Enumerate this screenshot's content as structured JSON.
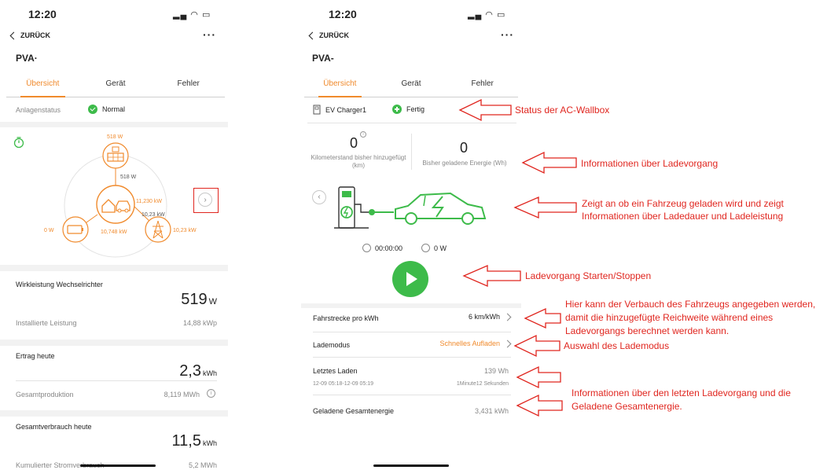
{
  "phone1": {
    "time": "12:20",
    "back_label": "ZURÜCK",
    "title": "PVA·",
    "tabs": [
      "Übersicht",
      "Gerät",
      "Fehler"
    ],
    "status_label": "Anlagenstatus",
    "status_value": "Normal",
    "flow": {
      "pv": "518 W",
      "pv_to_home": "518 W",
      "grid_in": "11,230 kW",
      "grid_a": "10,23 kW",
      "grid_b": "10,23 kW",
      "battery": "0 W",
      "home_to_grid": "10,748 kW"
    },
    "wirk_label": "Wirkleistung Wechselrichter",
    "wirk_value": "519",
    "wirk_unit": "W",
    "inst_label": "Installierte Leistung",
    "inst_value": "14,88 kWp",
    "ertrag_label": "Ertrag heute",
    "ertrag_value": "2,3",
    "ertrag_unit": "kWh",
    "gesamt_label": "Gesamtproduktion",
    "gesamt_value": "8,119 MWh",
    "verbrauch_label": "Gesamtverbrauch heute",
    "verbrauch_value": "11,5",
    "verbrauch_unit": "kWh",
    "kumul_label": "Kumulierter Stromverbrauch",
    "kumul_value": "5,2 MWh"
  },
  "phone2": {
    "time": "12:20",
    "back_label": "ZURÜCK",
    "title": "PVA-",
    "tabs": [
      "Übersicht",
      "Gerät",
      "Fehler"
    ],
    "charger_name": "EV Charger1",
    "charger_status": "Fertig",
    "km_value": "0",
    "km_label": "Kilometerstand bisher hinzugefügt (km)",
    "energy_value": "0",
    "energy_label": "Bisher geladene Energie (Wh)",
    "duration": "00:00:00",
    "power": "0 W",
    "rows": [
      {
        "label": "Fahrstrecke pro kWh",
        "value": "6 km/kWh"
      },
      {
        "label": "Lademodus",
        "value": "Schnelles Aufladen"
      }
    ],
    "last_label": "Letztes Laden",
    "last_value": "139 Wh",
    "last_time": "12-09 05:18-12-09 05:19",
    "last_duration": "1Minute12 Sekunden",
    "total_label": "Geladene Gesamtenergie",
    "total_value": "3,431 kWh"
  },
  "annotations": {
    "status": "Status der AC-Wallbox",
    "info": "Informationen über Ladevorgang",
    "vehicle_1": "Zeigt an ob ein Fahrzeug geladen wird und zeigt",
    "vehicle_2": "Informationen über Ladedauer und Ladeleistung",
    "start": "Ladevorgang Starten/Stoppen",
    "consumption_1": "Hier kann der Verbauch des Fahrzeugs angegeben werden,",
    "consumption_2": "damit die hinzugefügte Reichweite während eines",
    "consumption_3": "Ladevorgangs berechnet werden kann.",
    "mode": "Auswahl des Lademodus",
    "last_1": "Informationen über den letzten Ladevorgang und die",
    "last_2": "Geladene Gesamtenergie."
  },
  "colors": {
    "accent": "#f08a2c",
    "ok": "#3dbb4a",
    "annotation": "#e0261f"
  }
}
